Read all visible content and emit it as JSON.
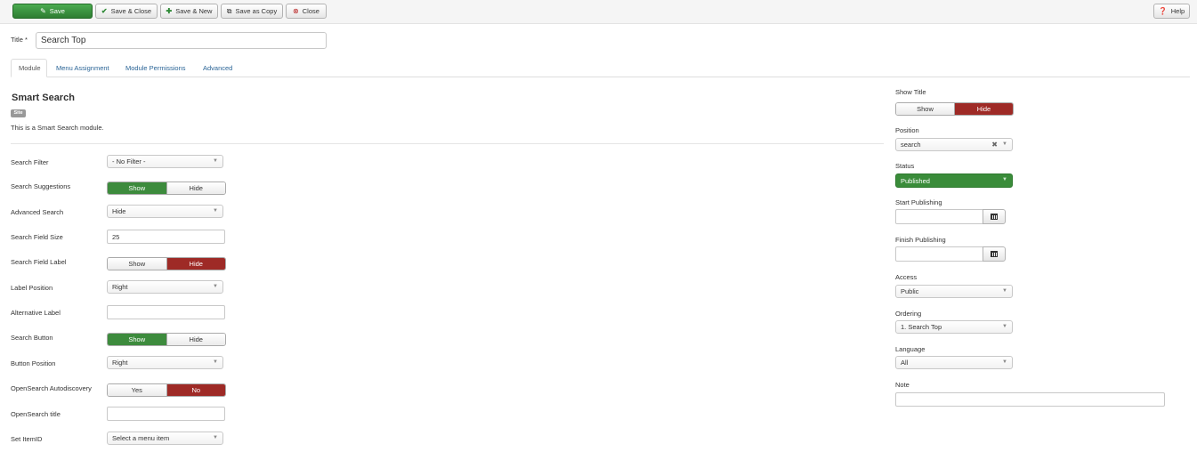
{
  "toolbar": {
    "save": "Save",
    "save_close": "Save & Close",
    "save_new": "Save & New",
    "save_copy": "Save as Copy",
    "close": "Close",
    "help": "Help"
  },
  "title": {
    "label": "Title *",
    "value": "Search Top"
  },
  "tabs": [
    "Module",
    "Menu Assignment",
    "Module Permissions",
    "Advanced"
  ],
  "module": {
    "name": "Smart Search",
    "badge": "Site",
    "description": "This is a Smart Search module."
  },
  "fields": {
    "search_filter": {
      "label": "Search Filter",
      "value": "- No Filter -"
    },
    "search_suggestions": {
      "label": "Search Suggestions",
      "options": [
        "Show",
        "Hide"
      ],
      "selected": "Show"
    },
    "advanced_search": {
      "label": "Advanced Search",
      "value": "Hide"
    },
    "search_field_size": {
      "label": "Search Field Size",
      "value": "25"
    },
    "search_field_label": {
      "label": "Search Field Label",
      "options": [
        "Show",
        "Hide"
      ],
      "selected": "Hide"
    },
    "label_position": {
      "label": "Label Position",
      "value": "Right"
    },
    "alternative_label": {
      "label": "Alternative Label",
      "value": ""
    },
    "search_button": {
      "label": "Search Button",
      "options": [
        "Show",
        "Hide"
      ],
      "selected": "Show"
    },
    "button_position": {
      "label": "Button Position",
      "value": "Right"
    },
    "opensearch_autodiscovery": {
      "label": "OpenSearch Autodiscovery",
      "options": [
        "Yes",
        "No"
      ],
      "selected": "No"
    },
    "opensearch_title": {
      "label": "OpenSearch title",
      "value": ""
    },
    "set_itemid": {
      "label": "Set ItemID",
      "value": "Select a menu item"
    }
  },
  "sidebar": {
    "show_title": {
      "label": "Show Title",
      "options": [
        "Show",
        "Hide"
      ],
      "selected": "Hide"
    },
    "position": {
      "label": "Position",
      "value": "search"
    },
    "status": {
      "label": "Status",
      "value": "Published"
    },
    "start_publishing": {
      "label": "Start Publishing",
      "value": ""
    },
    "finish_publishing": {
      "label": "Finish Publishing",
      "value": ""
    },
    "access": {
      "label": "Access",
      "value": "Public"
    },
    "ordering": {
      "label": "Ordering",
      "value": "1. Search Top"
    },
    "language": {
      "label": "Language",
      "value": "All"
    },
    "note": {
      "label": "Note",
      "value": ""
    }
  },
  "colors": {
    "green": "#3d8b3d",
    "red": "#9e2a26",
    "link": "#2a6496"
  },
  "icons": {
    "save": "pencil-square-icon",
    "save_close": "checkmark-icon",
    "save_new": "plus-icon",
    "save_copy": "copy-icon",
    "close": "cancel-circle-icon",
    "help": "question-circle-icon",
    "calendar": "calendar-icon"
  }
}
